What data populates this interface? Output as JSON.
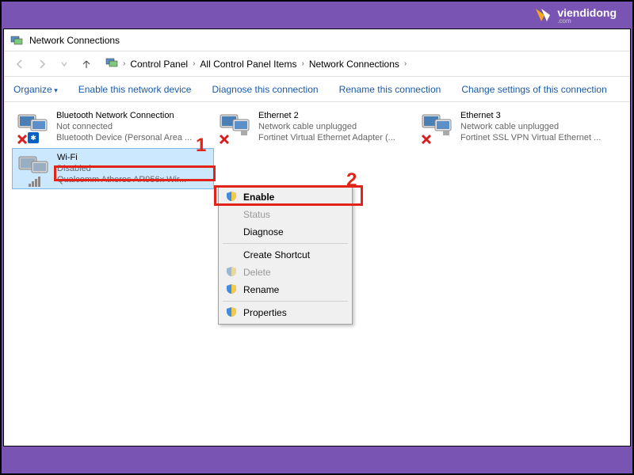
{
  "brand": {
    "name": "viendidong",
    "sub": ".com"
  },
  "window": {
    "title": "Network Connections"
  },
  "breadcrumb": [
    "Control Panel",
    "All Control Panel Items",
    "Network Connections"
  ],
  "toolbar": {
    "organize": "Organize",
    "enable": "Enable this network device",
    "diagnose": "Diagnose this connection",
    "rename": "Rename this connection",
    "settings": "Change settings of this connection"
  },
  "connections": [
    {
      "name": "Bluetooth Network Connection",
      "status": "Not connected",
      "device": "Bluetooth Device (Personal Area ...",
      "icon": "bluetooth",
      "red_x": true
    },
    {
      "name": "Ethernet 2",
      "status": "Network cable unplugged",
      "device": "Fortinet Virtual Ethernet Adapter (...",
      "icon": "ethernet",
      "red_x": true
    },
    {
      "name": "Ethernet 3",
      "status": "Network cable unplugged",
      "device": "Fortinet SSL VPN Virtual Ethernet ...",
      "icon": "ethernet",
      "red_x": true
    },
    {
      "name": "Wi-Fi",
      "status": "Disabled",
      "device": "Qualcomm Atheros AR956x Wir...",
      "icon": "wifi",
      "red_x": false,
      "selected": true
    }
  ],
  "context_menu": [
    {
      "label": "Enable",
      "shield": true,
      "bold": true,
      "disabled": false
    },
    {
      "label": "Status",
      "shield": false,
      "disabled": true
    },
    {
      "label": "Diagnose",
      "shield": false,
      "disabled": false
    },
    {
      "sep": true
    },
    {
      "label": "Create Shortcut",
      "shield": false,
      "disabled": false
    },
    {
      "label": "Delete",
      "shield": true,
      "disabled": true
    },
    {
      "label": "Rename",
      "shield": true,
      "disabled": false
    },
    {
      "sep": true
    },
    {
      "label": "Properties",
      "shield": true,
      "disabled": false
    }
  ],
  "annotations": {
    "num1": "1",
    "num2": "2"
  }
}
